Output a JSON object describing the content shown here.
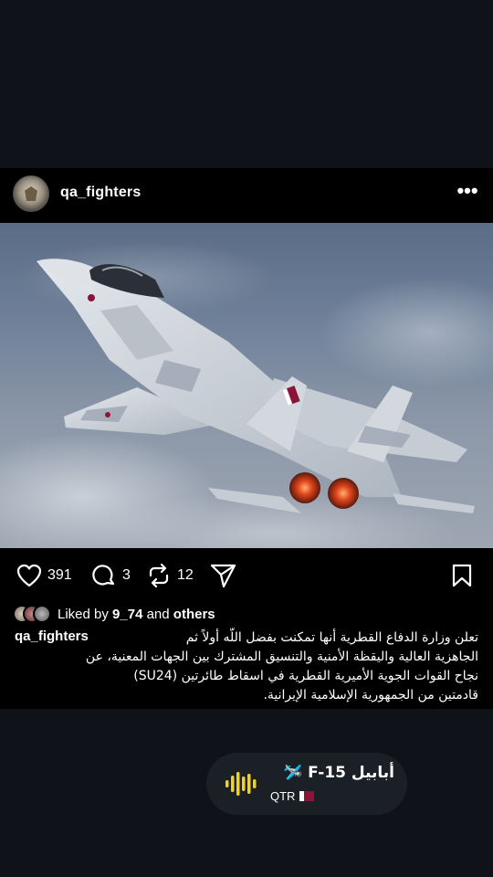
{
  "post": {
    "username": "qa_fighters",
    "more_glyph": "•••",
    "likes": "391",
    "comments": "3",
    "reposts": "12",
    "liked_by_prefix": "Liked by ",
    "liked_by_user": "9_74",
    "liked_by_and": " and ",
    "liked_by_others": "others",
    "caption_user": "qa_fighters",
    "caption": "تعلن وزارة الدفاع القطرية أنها تمكنت بفضل اللّه أولاً ثم\nالجاهزية العالية واليقظة الأمنية والتنسيق المشترك بين الجهات المعنية، عن\nنجاح القوات الجوية الأميرية القطرية في اسقاط طائرتين (SU24)\nقادمتين من الجمهورية الإسلامية الإيرانية."
  },
  "music": {
    "title": "أبابيل F-15 🛩️",
    "artist": "QTR"
  },
  "colors": {
    "background": "#0f1319",
    "post_background": "#000000",
    "jet_gray": "#c9cfd6",
    "qatar_maroon": "#8a1538"
  }
}
